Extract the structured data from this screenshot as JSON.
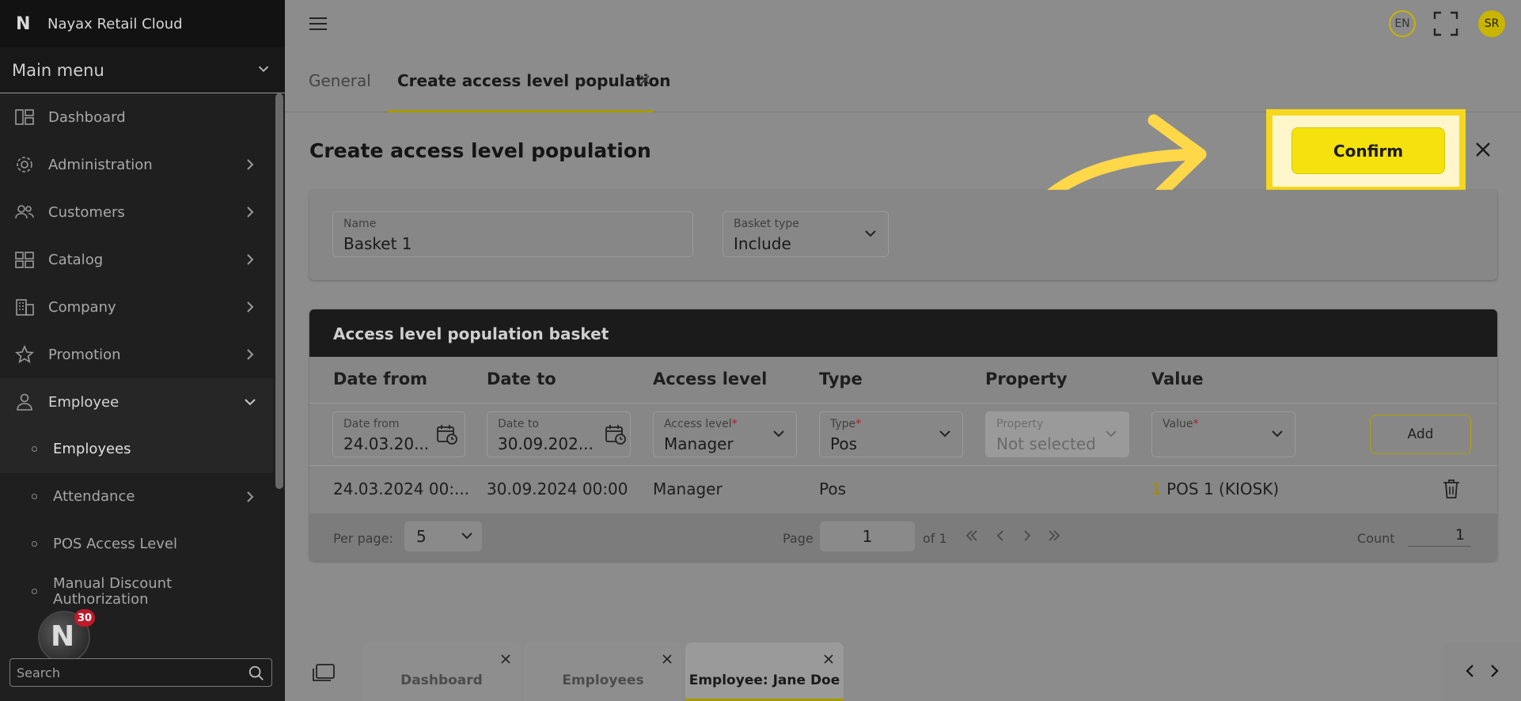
{
  "app": {
    "brand_logo": "N",
    "brand_name": "Nayax Retail Cloud"
  },
  "sidebar": {
    "main_menu": "Main menu",
    "items": [
      {
        "label": "Dashboard",
        "icon": "dashboard-icon"
      },
      {
        "label": "Administration",
        "icon": "gear-icon"
      },
      {
        "label": "Customers",
        "icon": "users-icon"
      },
      {
        "label": "Catalog",
        "icon": "catalog-icon"
      },
      {
        "label": "Company",
        "icon": "building-icon"
      },
      {
        "label": "Promotion",
        "icon": "star-icon"
      },
      {
        "label": "Employee",
        "icon": "person-icon"
      }
    ],
    "sub_items": [
      {
        "label": "Employees"
      },
      {
        "label": "Attendance"
      },
      {
        "label": "POS Access Level"
      },
      {
        "label": "Manual Discount Authorization"
      }
    ],
    "search_placeholder": "Search",
    "notification_count": "30"
  },
  "topbar": {
    "language": "EN",
    "user_initials": "SR"
  },
  "tabs": [
    {
      "label": "General"
    },
    {
      "label": "Create access level population"
    }
  ],
  "page": {
    "title": "Create access level population",
    "confirm_label": "Confirm",
    "name_field": {
      "label": "Name",
      "value": "Basket 1"
    },
    "basket_type_field": {
      "label": "Basket type",
      "value": "Include"
    }
  },
  "basket": {
    "title": "Access level population basket",
    "columns": [
      "Date from",
      "Date to",
      "Access level",
      "Type",
      "Property",
      "Value"
    ],
    "filters": {
      "date_from": {
        "label": "Date from",
        "value": "24.03.20..."
      },
      "date_to": {
        "label": "Date to",
        "value": "30.09.202..."
      },
      "access_level": {
        "label": "Access level",
        "value": "Manager"
      },
      "type": {
        "label": "Type",
        "value": "Pos"
      },
      "property": {
        "label": "Property",
        "value": "Not selected"
      },
      "value": {
        "label": "Value",
        "value": ""
      }
    },
    "required_mark": "*",
    "add_label": "Add",
    "row": {
      "date_from": "24.03.2024 00:...",
      "date_to": "30.09.2024 00:00",
      "access_level": "Manager",
      "type": "Pos",
      "value_count": "1",
      "value_text": "POS 1 (KIOSK)"
    },
    "pagination": {
      "per_page_label": "Per page:",
      "per_page_value": "5",
      "page_label": "Page",
      "page_value": "1",
      "of_label": "of 1",
      "count_label": "Count",
      "count_value": "1"
    }
  },
  "bottom_tabs": [
    {
      "label": "Dashboard"
    },
    {
      "label": "Employees"
    },
    {
      "label": "Employee: Jane Doe"
    }
  ],
  "colors": {
    "accent": "#f4e10e",
    "highlight": "#f5d81c",
    "sidebar": "#1f1f1f"
  }
}
